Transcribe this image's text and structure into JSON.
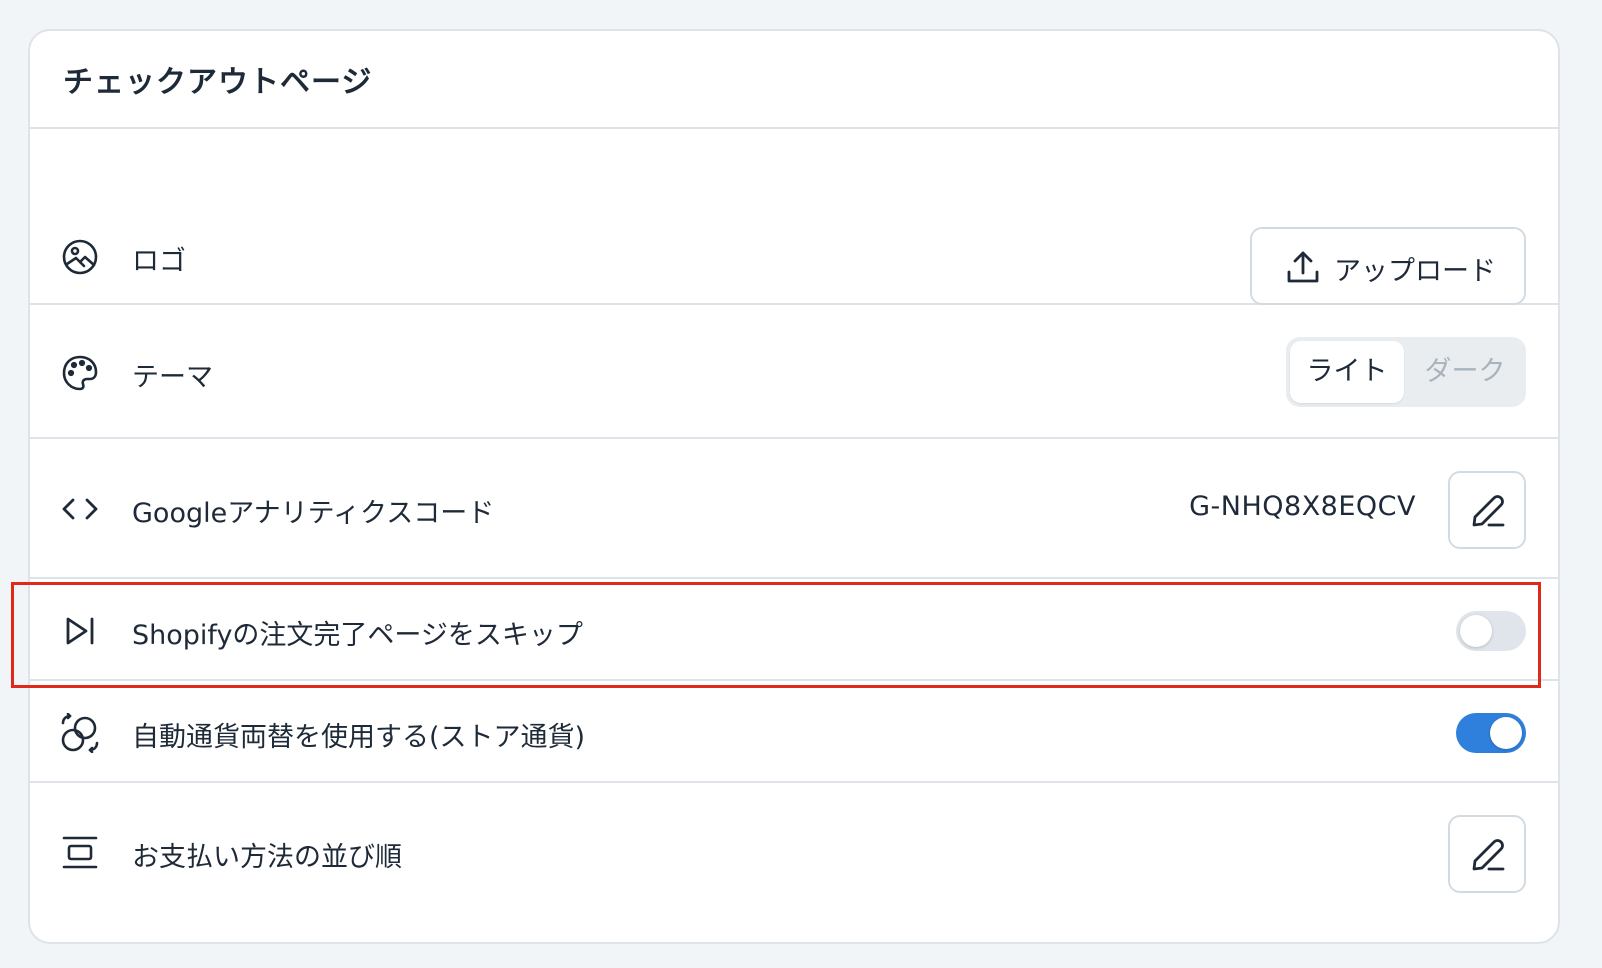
{
  "card": {
    "title": "チェックアウトページ"
  },
  "rows": {
    "logo": {
      "icon": "image-icon",
      "label": "ロゴ",
      "button_icon": "upload-icon",
      "button_label": "アップロード"
    },
    "theme": {
      "icon": "palette-icon",
      "label": "テーマ",
      "options": [
        "ライト",
        "ダーク"
      ],
      "selected": "ライト"
    },
    "analytics": {
      "icon": "code-icon",
      "label": "Googleアナリティクスコード",
      "value": "G-NHQ8X8EQCV",
      "button_icon": "pencil-icon"
    },
    "skip_thankyou": {
      "icon": "skip-forward-icon",
      "label": "Shopifyの注文完了ページをスキップ",
      "enabled": false
    },
    "auto_currency": {
      "icon": "currency-exchange-icon",
      "label": "自動通貨両替を使用する(ストア通貨)",
      "enabled": true
    },
    "payment_order": {
      "icon": "list-order-icon",
      "label": "お支払い方法の並び順",
      "button_icon": "pencil-icon"
    }
  },
  "colors": {
    "accent": "#2f7fdc",
    "highlight": "#e0291b",
    "toggle_off": "#dfe5ea",
    "text": "#1e2a38"
  }
}
